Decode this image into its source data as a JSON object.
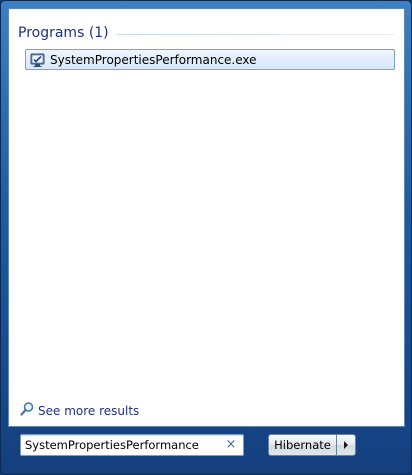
{
  "results": {
    "group_title": "Programs (1)",
    "items": [
      {
        "label": "SystemPropertiesPerformance.exe",
        "icon": "system-properties-icon"
      }
    ]
  },
  "see_more": {
    "label": "See more results",
    "icon": "magnifier-icon"
  },
  "search": {
    "value": "SystemPropertiesPerformance",
    "clear_icon": "close-icon",
    "clear_glyph": "×"
  },
  "shutdown": {
    "label": "Hibernate",
    "arrow_icon": "chevron-right-icon"
  },
  "colors": {
    "group_title": "#1e3287",
    "link": "#1e3287",
    "selection_border": "#7da2ce",
    "frame": "#1f5aa0"
  }
}
